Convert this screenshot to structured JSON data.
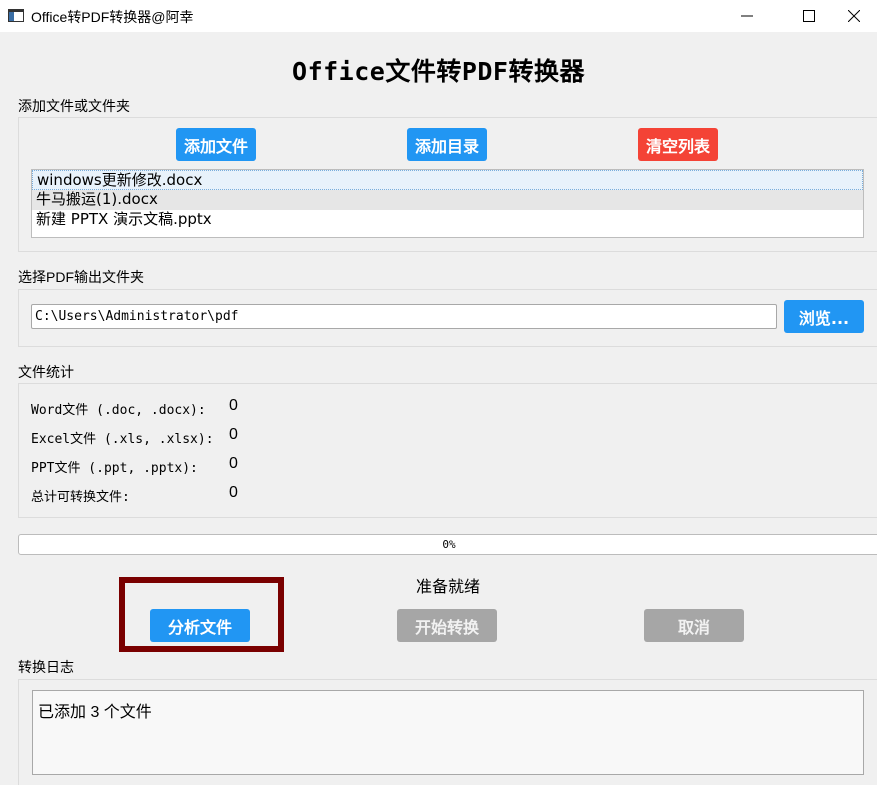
{
  "window": {
    "title": "Office转PDF转换器@阿幸",
    "icon": "window-app-icon",
    "controls": [
      "minimize-icon",
      "maximize-icon",
      "close-icon"
    ]
  },
  "header": {
    "title": "Office文件转PDF转换器"
  },
  "add_section": {
    "label": "添加文件或文件夹",
    "add_file": "添加文件",
    "add_dir": "添加目录",
    "clear_list": "清空列表",
    "files": [
      "windows更新修改.docx",
      "牛马搬运(1).docx",
      "新建 PPTX 演示文稿.pptx"
    ]
  },
  "output_section": {
    "label": "选择PDF输出文件夹",
    "path": "C:\\Users\\Administrator\\pdf",
    "browse": "浏览..."
  },
  "stats_section": {
    "label": "文件统计",
    "rows": [
      {
        "label": "Word文件 (.doc, .docx):",
        "value": "0"
      },
      {
        "label": "Excel文件 (.xls, .xlsx):",
        "value": "0"
      },
      {
        "label": "PPT文件 (.ppt, .pptx):",
        "value": "0"
      },
      {
        "label": "总计可转换文件:",
        "value": "0"
      }
    ]
  },
  "progress": {
    "value": 0,
    "text": "0%"
  },
  "status": {
    "text": "准备就绪"
  },
  "actions": {
    "analyze": "分析文件",
    "start": "开始转换",
    "cancel": "取消"
  },
  "log_section": {
    "label": "转换日志",
    "content": "已添加 3 个文件"
  },
  "colors": {
    "primary": "#2196f3",
    "danger": "#f44336",
    "disabled": "#a6a6a6",
    "highlight_border": "#7a0000"
  }
}
